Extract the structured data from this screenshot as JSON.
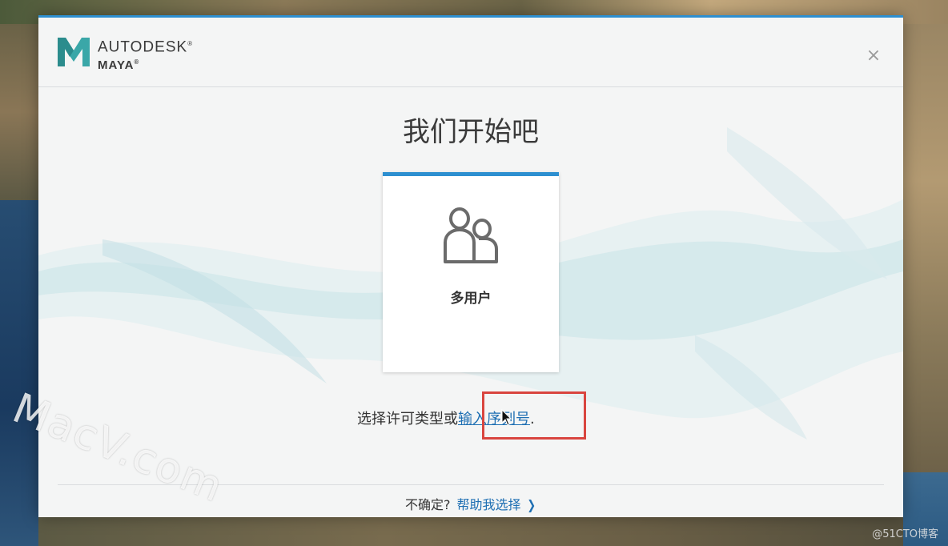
{
  "app": {
    "brand_line1": "AUTODESK",
    "brand_line2": "MAYA",
    "close_symbol": "×"
  },
  "main": {
    "title": "我们开始吧",
    "card_label": "多用户",
    "card_icon": "users-icon",
    "choose_text": "选择许可类型或",
    "serial_link": "输入序列号",
    "period": "."
  },
  "footer": {
    "unsure_text": "不确定?",
    "help_link": "帮助我选择",
    "chevron": "❯"
  },
  "overlay": {
    "watermark": "MacV.com",
    "credit": "@51CTO博客"
  },
  "colors": {
    "accent": "#2d8fd0",
    "link": "#1e6fb3",
    "highlight": "#d9453f",
    "logo": "#3aa7a8"
  }
}
